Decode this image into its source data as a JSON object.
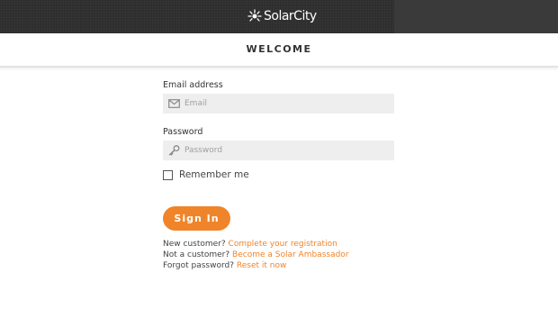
{
  "header": {
    "brand": "SolarCity"
  },
  "welcome": {
    "title": "WELCOME"
  },
  "form": {
    "email_label": "Email address",
    "email_placeholder": "Email",
    "password_label": "Password",
    "password_placeholder": "Password",
    "remember_label": "Remember me",
    "signin_label": "Sign In"
  },
  "links": [
    {
      "prefix": "New customer?",
      "link": "Complete your registration"
    },
    {
      "prefix": "Not a customer?",
      "link": "Become a Solar Ambassador"
    },
    {
      "prefix": "Forgot password?",
      "link": "Reset it now"
    }
  ],
  "colors": {
    "accent": "#f0842a",
    "header_bg": "#2e2e2e",
    "input_bg": "#eeeeee"
  },
  "icons": {
    "logo": "sun-icon",
    "email": "envelope-icon",
    "password": "key-icon"
  }
}
